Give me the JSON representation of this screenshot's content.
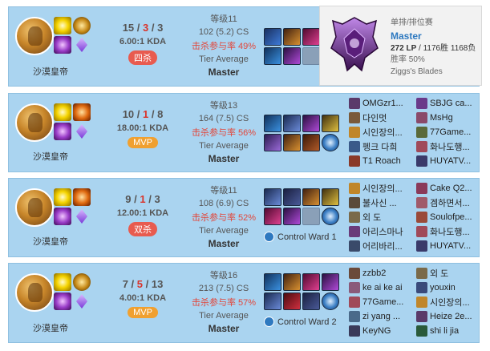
{
  "rank_panel": {
    "queue": "单排/排位赛",
    "tier": "Master",
    "lp": "272 LP",
    "record": "/ 1176胜 1168负",
    "winrate": "胜率 50%",
    "league": "Ziggs's Blades"
  },
  "matches": [
    {
      "champion": "沙漠皇帝",
      "kills": "15",
      "deaths": "3",
      "assists": "3",
      "kda": "6.00:1 KDA",
      "badge": "四杀",
      "badge_color": "red",
      "level": "等级11",
      "cs": "102 (5.2) CS",
      "kp": "击杀参与率 49%",
      "tier_label": "Tier Average",
      "tier": "Master",
      "ward": "",
      "players_left": [],
      "players_right": []
    },
    {
      "champion": "沙漠皇帝",
      "kills": "10",
      "deaths": "1",
      "assists": "8",
      "kda": "18.00:1 KDA",
      "badge": "MVP",
      "badge_color": "orange",
      "level": "等级13",
      "cs": "164 (7.5) CS",
      "kp": "击杀参与率 56%",
      "tier_label": "Tier Average",
      "tier": "Master",
      "ward": "",
      "players_left": [
        "OMGzr1...",
        "다인멋",
        "시인장의...",
        "펭크 다희",
        "T1 Roach"
      ],
      "players_right": [
        "SBJG ca...",
        "MsHg",
        "77Game...",
        "화나도행...",
        "HUYATV..."
      ]
    },
    {
      "champion": "沙漠皇帝",
      "kills": "9",
      "deaths": "1",
      "assists": "3",
      "kda": "12.00:1 KDA",
      "badge": "双杀",
      "badge_color": "red",
      "level": "等级11",
      "cs": "108 (6.9) CS",
      "kp": "击杀参与率 52%",
      "tier_label": "Tier Average",
      "tier": "Master",
      "ward": "Control Ward 1",
      "players_left": [
        "시인장의...",
        "불사신 ...",
        "외 도",
        "아리스마나",
        "어리바리..."
      ],
      "players_right": [
        "Cake Q2...",
        "겜하면서...",
        "Soulofpe...",
        "화나도행...",
        "HUYATV..."
      ]
    },
    {
      "champion": "沙漠皇帝",
      "kills": "7",
      "deaths": "5",
      "assists": "13",
      "kda": "4.00:1 KDA",
      "badge": "MVP",
      "badge_color": "orange",
      "level": "等级16",
      "cs": "213 (7.5) CS",
      "kp": "击杀参与率 57%",
      "tier_label": "Tier Average",
      "tier": "Master",
      "ward": "Control Ward 2",
      "players_left": [
        "zzbb2",
        "ke ai ke ai",
        "77Game...",
        "zi yang ...",
        "KeyNG"
      ],
      "players_right": [
        "외 도",
        "youxin",
        "시인장의...",
        "Heize 2e...",
        "shi li jia"
      ]
    }
  ]
}
